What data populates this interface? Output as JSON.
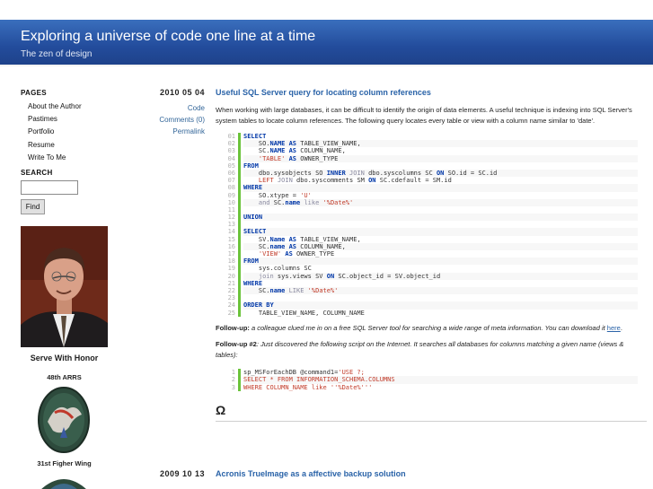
{
  "header": {
    "title": "Exploring a universe of code one line at a time",
    "subtitle": "The zen of design"
  },
  "sidebar": {
    "pages_heading": "PAGES",
    "pages": [
      "About the Author",
      "Pastimes",
      "Portfolio",
      "Resume",
      "Write To Me"
    ],
    "search_heading": "SEARCH",
    "search_value": "",
    "find_label": "Find",
    "photo_caption": "Serve With Honor",
    "unit1": "48th ARRS",
    "unit2": "31st Figher Wing"
  },
  "post1": {
    "date": "2010 05 04",
    "code_link": "Code",
    "comments": "Comments (0)",
    "permalink": "Permalink",
    "title": "Useful SQL Server query for locating column references",
    "intro": "When working with large databases, it can be difficult to identify the origin of data elements.  A useful technique is indexing into SQL Server's system tables to locate column references.  The following query locates every table or view with a column name similar to 'date'.",
    "followup_label": "Follow-up:",
    "followup_text": " a colleague clued me in on a free SQL Server tool for searching a wide range of meta information. You can download it ",
    "followup_link": "here",
    "followup_end": ".",
    "followup2_label": "Follow-up #2",
    "followup2_text": ":  Just discovered the following script on the Internet.  It searches all databases for columns matching a given name (views & tables):",
    "omega": "Ω"
  },
  "code1": [
    {
      "n": "01",
      "h": "<span class='kw'>SELECT</span>"
    },
    {
      "n": "02",
      "h": "    SO.<span class='kw'>NAME</span> <span class='kw'>AS</span> TABLE_VIEW_NAME,"
    },
    {
      "n": "03",
      "h": "    SC.<span class='kw'>NAME</span> <span class='kw'>AS</span> COLUMN_NAME,"
    },
    {
      "n": "04",
      "h": "    <span class='st'>'TABLE'</span> <span class='kw'>AS</span> OWNER_TYPE"
    },
    {
      "n": "05",
      "h": "<span class='kw'>FROM</span>"
    },
    {
      "n": "06",
      "h": "    dbo.sysobjects SO <span class='kw'>INNER</span> <span class='kw2'>JOIN</span> dbo.syscolumns SC <span class='kw'>ON</span> SO.id = SC.id"
    },
    {
      "n": "07",
      "h": "    <span class='st'>LEFT</span> <span class='kw2'>JOIN</span> dbo.syscomments SM <span class='kw'>ON</span> SC.cdefault = SM.id"
    },
    {
      "n": "08",
      "h": "<span class='kw'>WHERE</span>"
    },
    {
      "n": "09",
      "h": "    SO.xtype = <span class='st'>'U'</span>"
    },
    {
      "n": "10",
      "h": "    <span class='kw2'>and</span> SC.<span class='kw'>name</span> <span class='kw2'>like</span> <span class='st'>'%Date%'</span>"
    },
    {
      "n": "11",
      "h": ""
    },
    {
      "n": "12",
      "h": "<span class='kw'>UNION</span>"
    },
    {
      "n": "13",
      "h": ""
    },
    {
      "n": "14",
      "h": "<span class='kw'>SELECT</span>"
    },
    {
      "n": "15",
      "h": "    SV.<span class='kw'>Name</span> <span class='kw'>AS</span> TABLE_VIEW_NAME,"
    },
    {
      "n": "16",
      "h": "    SC.<span class='kw'>name</span> <span class='kw'>AS</span> COLUMN_NAME,"
    },
    {
      "n": "17",
      "h": "    <span class='st'>'VIEW'</span> <span class='kw'>AS</span> OWNER_TYPE"
    },
    {
      "n": "18",
      "h": "<span class='kw'>FROM</span>"
    },
    {
      "n": "19",
      "h": "    sys.columns SC"
    },
    {
      "n": "20",
      "h": "    <span class='kw2'>join</span> sys.views SV <span class='kw'>ON</span> SC.object_id = SV.object_id"
    },
    {
      "n": "21",
      "h": "<span class='kw'>WHERE</span>"
    },
    {
      "n": "22",
      "h": "    SC.<span class='kw'>name</span> <span class='kw2'>LIKE</span> <span class='st'>'%Date%'</span>"
    },
    {
      "n": "23",
      "h": ""
    },
    {
      "n": "24",
      "h": "<span class='kw'>ORDER</span> <span class='kw'>BY</span>"
    },
    {
      "n": "25",
      "h": "    TABLE_VIEW_NAME, COLUMN_NAME"
    }
  ],
  "code2": [
    {
      "n": "1",
      "h": "sp_MSForEachDB @command1=<span class='st'>'USE ?;</span>"
    },
    {
      "n": "2",
      "h": "<span class='st'>SELECT * FROM INFORMATION_SCHEMA.COLUMNS</span>"
    },
    {
      "n": "3",
      "h": "<span class='st'>WHERE COLUMN_NAME like ''%Date%'''</span>"
    }
  ],
  "post2": {
    "date": "2009 10 13",
    "title": "Acronis TrueImage as a affective backup solution"
  }
}
